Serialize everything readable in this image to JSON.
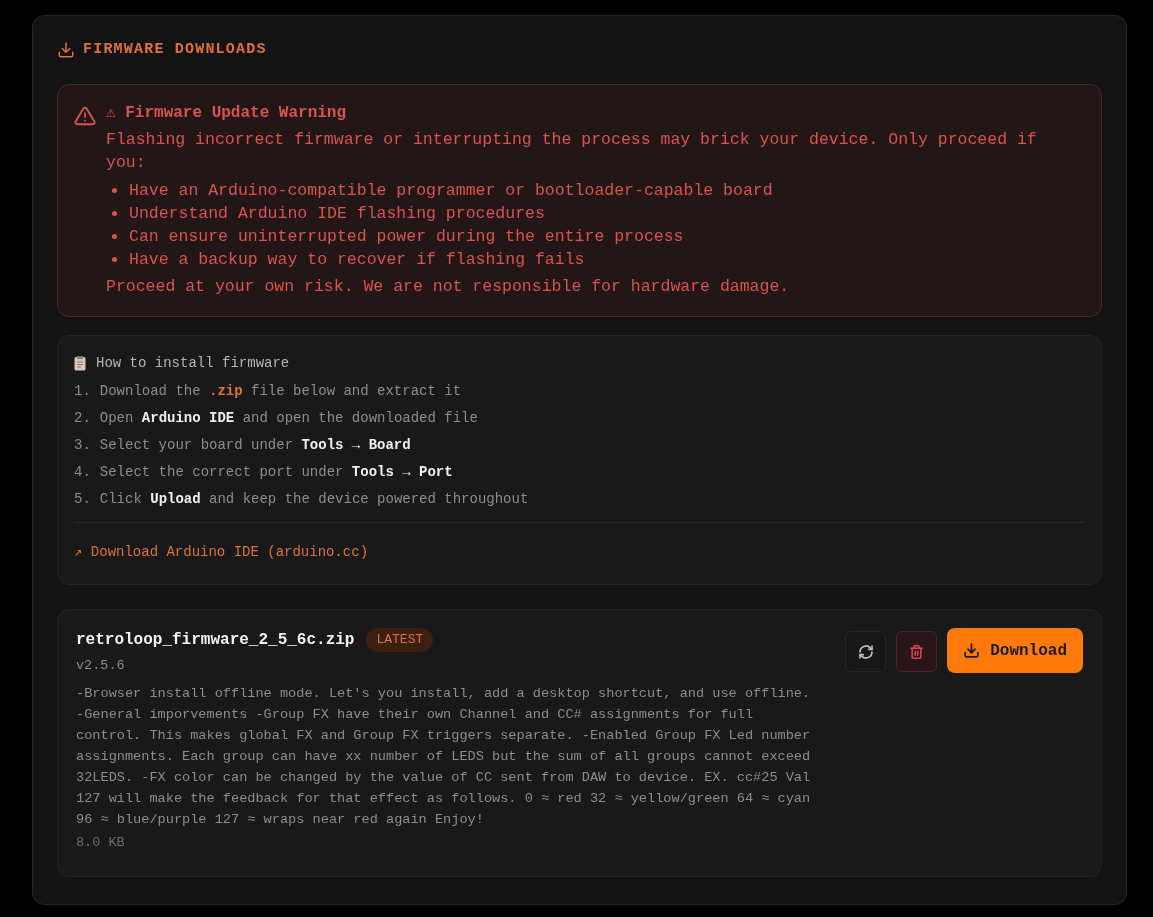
{
  "header": {
    "title": "FIRMWARE DOWNLOADS"
  },
  "warning": {
    "title": "⚠ Firmware Update Warning",
    "intro": "Flashing incorrect firmware or interrupting the process may brick your device. Only proceed if you:",
    "items": [
      "Have an Arduino-compatible programmer or bootloader-capable board",
      "Understand Arduino IDE flashing procedures",
      "Can ensure uninterrupted power during the entire process",
      "Have a backup way to recover if flashing fails"
    ],
    "footer": "Proceed at your own risk. We are not responsible for hardware damage."
  },
  "instructions": {
    "title": "How to install firmware",
    "steps": [
      {
        "number": "1.",
        "parts": [
          {
            "text": "Download the ",
            "kind": "plain"
          },
          {
            "text": ".zip",
            "kind": "accent"
          },
          {
            "text": " file below and extract it",
            "kind": "plain"
          }
        ]
      },
      {
        "number": "2.",
        "parts": [
          {
            "text": "Open ",
            "kind": "plain"
          },
          {
            "text": "Arduino IDE",
            "kind": "strong"
          },
          {
            "text": " and open the downloaded file",
            "kind": "plain"
          }
        ]
      },
      {
        "number": "3.",
        "parts": [
          {
            "text": "Select your board under ",
            "kind": "plain"
          },
          {
            "text": "Tools → Board",
            "kind": "strong"
          }
        ]
      },
      {
        "number": "4.",
        "parts": [
          {
            "text": "Select the correct port under ",
            "kind": "plain"
          },
          {
            "text": "Tools → Port",
            "kind": "strong"
          }
        ]
      },
      {
        "number": "5.",
        "parts": [
          {
            "text": "Click ",
            "kind": "plain"
          },
          {
            "text": "Upload",
            "kind": "strong"
          },
          {
            "text": " and keep the device powered throughout",
            "kind": "plain"
          }
        ]
      }
    ],
    "link": "↗ Download Arduino IDE (arduino.cc)"
  },
  "files": [
    {
      "name": "retroloop_firmware_2_5_6c.zip",
      "badge": "LATEST",
      "version": "v2.5.6",
      "description": "-Browser install offline mode. Let's you install, add a desktop shortcut, and use offline. -General imporvements -Group FX have their own Channel and CC# assignments for full control. This makes global FX and Group FX triggers separate. -Enabled Group FX Led number assignments. Each group can have xx number of LEDS but the sum of all groups cannot exceed 32LEDS. -FX color can be changed by the value of CC sent from DAW to device. EX. cc#25 Val 127 will make the feedback for that effect as follows. 0 ≈ red 32 ≈ yellow/green 64 ≈ cyan 96 ≈ blue/purple 127 ≈ wraps near red again Enjoy!",
      "size": "8.0 KB",
      "download_label": "Download"
    }
  ]
}
